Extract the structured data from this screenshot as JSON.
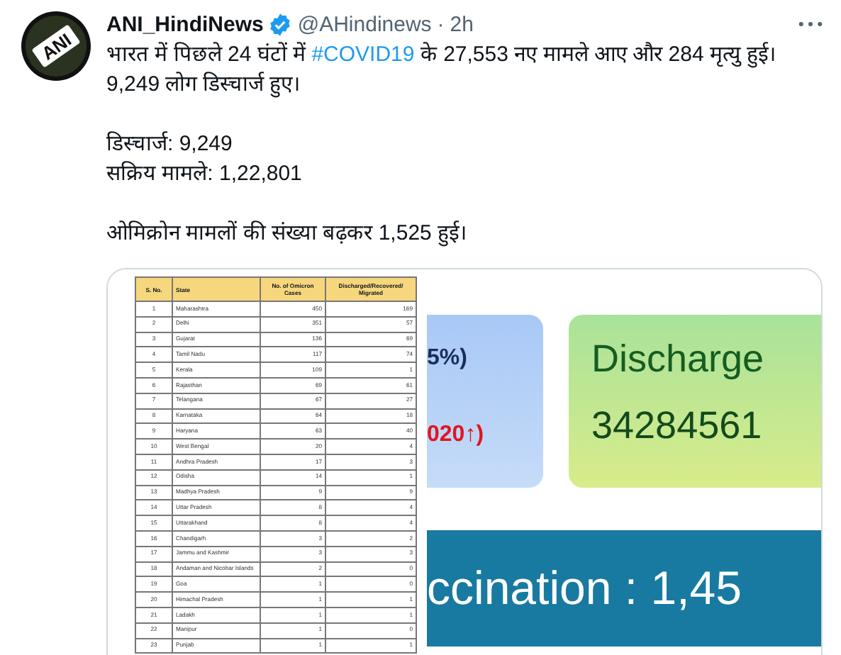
{
  "tweet": {
    "avatar": {
      "logo_text": "ANI"
    },
    "author": {
      "name": "ANI_HindiNews",
      "verified": true,
      "handle": "@AHindinews",
      "separator": "·",
      "time": "2h"
    },
    "body": [
      {
        "before": "भारत में पिछले 24 घंटों में ",
        "hashtag": "#COVID19",
        "after": " के 27,553 नए मामले आए  और 284 मृत्यु हुई। 9,249 लोग डिस्चार्ज हुए।"
      }
    ],
    "lines": [
      "डिस्चार्ज: 9,249",
      "सक्रिय मामले: 1,22,801"
    ],
    "closing": "ओमिक्रोन मामलों की संख्या बढ़कर 1,525 हुई।",
    "media": {
      "table": {
        "columns": [
          "S. No.",
          "State",
          "No. of Omicron Cases",
          "Discharged/Recovered/ Migrated"
        ],
        "rows": [
          [
            "1",
            "Maharashtra",
            "450",
            "169"
          ],
          [
            "2",
            "Delhi",
            "351",
            "57"
          ],
          [
            "3",
            "Gujarat",
            "136",
            "69"
          ],
          [
            "4",
            "Tamil Nadu",
            "117",
            "74"
          ],
          [
            "5",
            "Kerala",
            "109",
            "1"
          ],
          [
            "6",
            "Rajasthan",
            "69",
            "61"
          ],
          [
            "7",
            "Telangana",
            "67",
            "27"
          ],
          [
            "8",
            "Karnataka",
            "64",
            "18"
          ],
          [
            "9",
            "Haryana",
            "63",
            "40"
          ],
          [
            "10",
            "West Bengal",
            "20",
            "4"
          ],
          [
            "11",
            "Andhra Pradesh",
            "17",
            "3"
          ],
          [
            "12",
            "Odisha",
            "14",
            "1"
          ],
          [
            "13",
            "Madhya Pradesh",
            "9",
            "9"
          ],
          [
            "14",
            "Uttar Pradesh",
            "8",
            "4"
          ],
          [
            "15",
            "Uttarakhand",
            "8",
            "4"
          ],
          [
            "16",
            "Chandigarh",
            "3",
            "2"
          ],
          [
            "17",
            "Jammu and Kashmir",
            "3",
            "3"
          ],
          [
            "18",
            "Andaman and Nicobar Islands",
            "2",
            "0"
          ],
          [
            "19",
            "Goa",
            "1",
            "0"
          ],
          [
            "20",
            "Himachal Pradesh",
            "1",
            "1"
          ],
          [
            "21",
            "Ladakh",
            "1",
            "1"
          ],
          [
            "22",
            "Manipur",
            "1",
            "0"
          ],
          [
            "23",
            "Punjab",
            "1",
            "1"
          ]
        ]
      },
      "infographic": {
        "blue_card": {
          "line_1": "5%)",
          "line_2": "020↑)"
        },
        "green_card": {
          "title": "Discharge",
          "value": "34284561"
        },
        "banner": "ccination : 1,45"
      }
    }
  }
}
